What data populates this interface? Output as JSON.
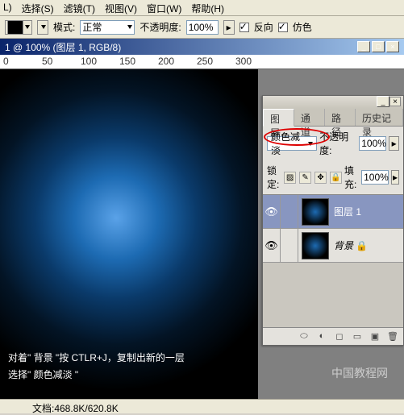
{
  "menu": {
    "items": [
      "L)",
      "选择(S)",
      "滤镜(T)",
      "视图(V)",
      "窗口(W)",
      "帮助(H)"
    ]
  },
  "toolbar": {
    "mode_label": "模式:",
    "mode_value": "正常",
    "opacity_label": "不透明度:",
    "opacity_value": "100%",
    "reverse_label": "反向",
    "dither_label": "仿色"
  },
  "doc": {
    "title": "1 @ 100% (图层 1, RGB/8)"
  },
  "ruler": {
    "marks": [
      "0",
      "50",
      "100",
      "150",
      "200",
      "250",
      "300"
    ]
  },
  "instruction": {
    "line1": "对着\" 背景 \"按 CTLR+J，复制出新的一层",
    "line2": "选择\" 颜色减淡 \""
  },
  "watermark": "中国教程网",
  "status": "文档:468.8K/620.8K",
  "panel": {
    "tabs": [
      "图层",
      "通道",
      "路径",
      "历史记录"
    ],
    "blend_value": "颜色减淡",
    "opacity_label": "不透明度:",
    "opacity_value": "100%",
    "lock_label": "锁定:",
    "fill_label": "填充:",
    "fill_value": "100%",
    "layers": [
      {
        "name": "图层 1",
        "selected": true,
        "italic": false
      },
      {
        "name": "背景",
        "selected": false,
        "italic": true
      }
    ]
  }
}
